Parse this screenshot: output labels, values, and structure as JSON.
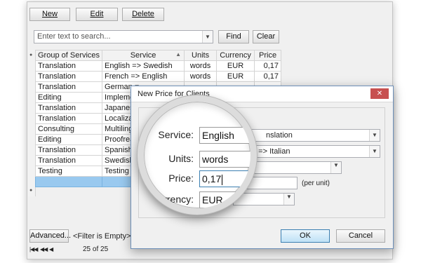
{
  "toolbar": {
    "new": "New",
    "edit": "Edit",
    "delete": "Delete"
  },
  "search": {
    "placeholder": "Enter text to search...",
    "find": "Find",
    "clear": "Clear"
  },
  "grid": {
    "columns": [
      "Group of Services",
      "Service",
      "Units",
      "Currency",
      "Price"
    ],
    "rows": [
      [
        "Translation",
        "English => Swedish",
        "words",
        "EUR",
        "0,17"
      ],
      [
        "Translation",
        "French => English",
        "words",
        "EUR",
        "0,17"
      ],
      [
        "Translation",
        "German =",
        "",
        "",
        ""
      ],
      [
        "Editing",
        "Implemen",
        "",
        "",
        ""
      ],
      [
        "Translation",
        "Japanese",
        "",
        "",
        ""
      ],
      [
        "Translation",
        "Localizati",
        "",
        "",
        ""
      ],
      [
        "Consulting",
        "Multilingu",
        "",
        "",
        ""
      ],
      [
        "Editing",
        "Proofread",
        "",
        "",
        ""
      ],
      [
        "Translation",
        "Spanish =",
        "",
        "",
        ""
      ],
      [
        "Translation",
        "Swedish =",
        "",
        "",
        ""
      ],
      [
        "Testing",
        "Testing of",
        "",
        "",
        ""
      ]
    ]
  },
  "footer": {
    "advanced": "Advanced...",
    "filter": "<Filter is Empty>",
    "record_count": "25 of 25"
  },
  "dialog": {
    "title": "New Price for Clients",
    "close_glyph": "✕",
    "service_tail": "nslation",
    "service2_tail": "h => Italian",
    "per_unit": "(per unit)",
    "ok": "OK",
    "cancel": "Cancel"
  },
  "magnifier": {
    "service_label": "Service:",
    "service_value": "English",
    "units_label": "Units:",
    "units_value": "words",
    "price_label": "Price:",
    "price_value": "0,17",
    "currency_label": "Currency:",
    "currency_value": "EUR"
  },
  "colors": {
    "selection": "#99c9ef",
    "close_button": "#c75050"
  }
}
